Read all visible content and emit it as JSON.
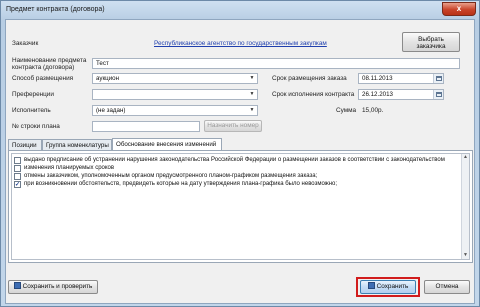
{
  "window": {
    "title": "Предмет контракта (договора)",
    "close_glyph": "x"
  },
  "form": {
    "customer_label": "Заказчик",
    "customer_value": "Республиканское агентство по государственным закупкам",
    "choose_customer_button": "Выбрать заказчика",
    "name_label": "Наименование предмета контракта (договора)",
    "name_value": "Тест",
    "method_label": "Способ размещения",
    "method_value": "аукцион",
    "preferences_label": "Преференции",
    "preferences_value": "",
    "executor_label": "Исполнитель",
    "executor_value": "(не задан)",
    "plan_row_label": "№ строки плана",
    "plan_row_value": "",
    "assign_number_button": "Назначить номер",
    "order_date_label": "Срок размещения заказа",
    "order_date_value": "08.11.2013",
    "execution_date_label": "Срок исполнения контракта",
    "execution_date_value": "26.12.2013",
    "sum_label": "Сумма",
    "sum_value": "15,00р."
  },
  "tabs": [
    {
      "label": "Позиции"
    },
    {
      "label": "Группа номенклатуры"
    },
    {
      "label": "Обоснование внесения изменений"
    }
  ],
  "changes_list": [
    {
      "text": "выдано предписание об устранении нарушения законодательства Российской Федерации о размещении заказов в соответствии с законодательством",
      "checked": false
    },
    {
      "text": "изменения планируемых сроков",
      "checked": false
    },
    {
      "text": "отмены заказчиком, уполномоченным органом предусмотренного планом-графиком размещения заказа;",
      "checked": false
    },
    {
      "text": "при возникновении обстоятельств, предвидеть которые на дату утверждения плана-графика было невозможно;",
      "checked": true
    }
  ],
  "footer": {
    "save_and_check_button": "Сохранить и проверить",
    "save_button": "Сохранить",
    "cancel_button": "Отмена"
  },
  "colors": {
    "highlight": "#d11c1c",
    "link": "#1f3fae"
  }
}
